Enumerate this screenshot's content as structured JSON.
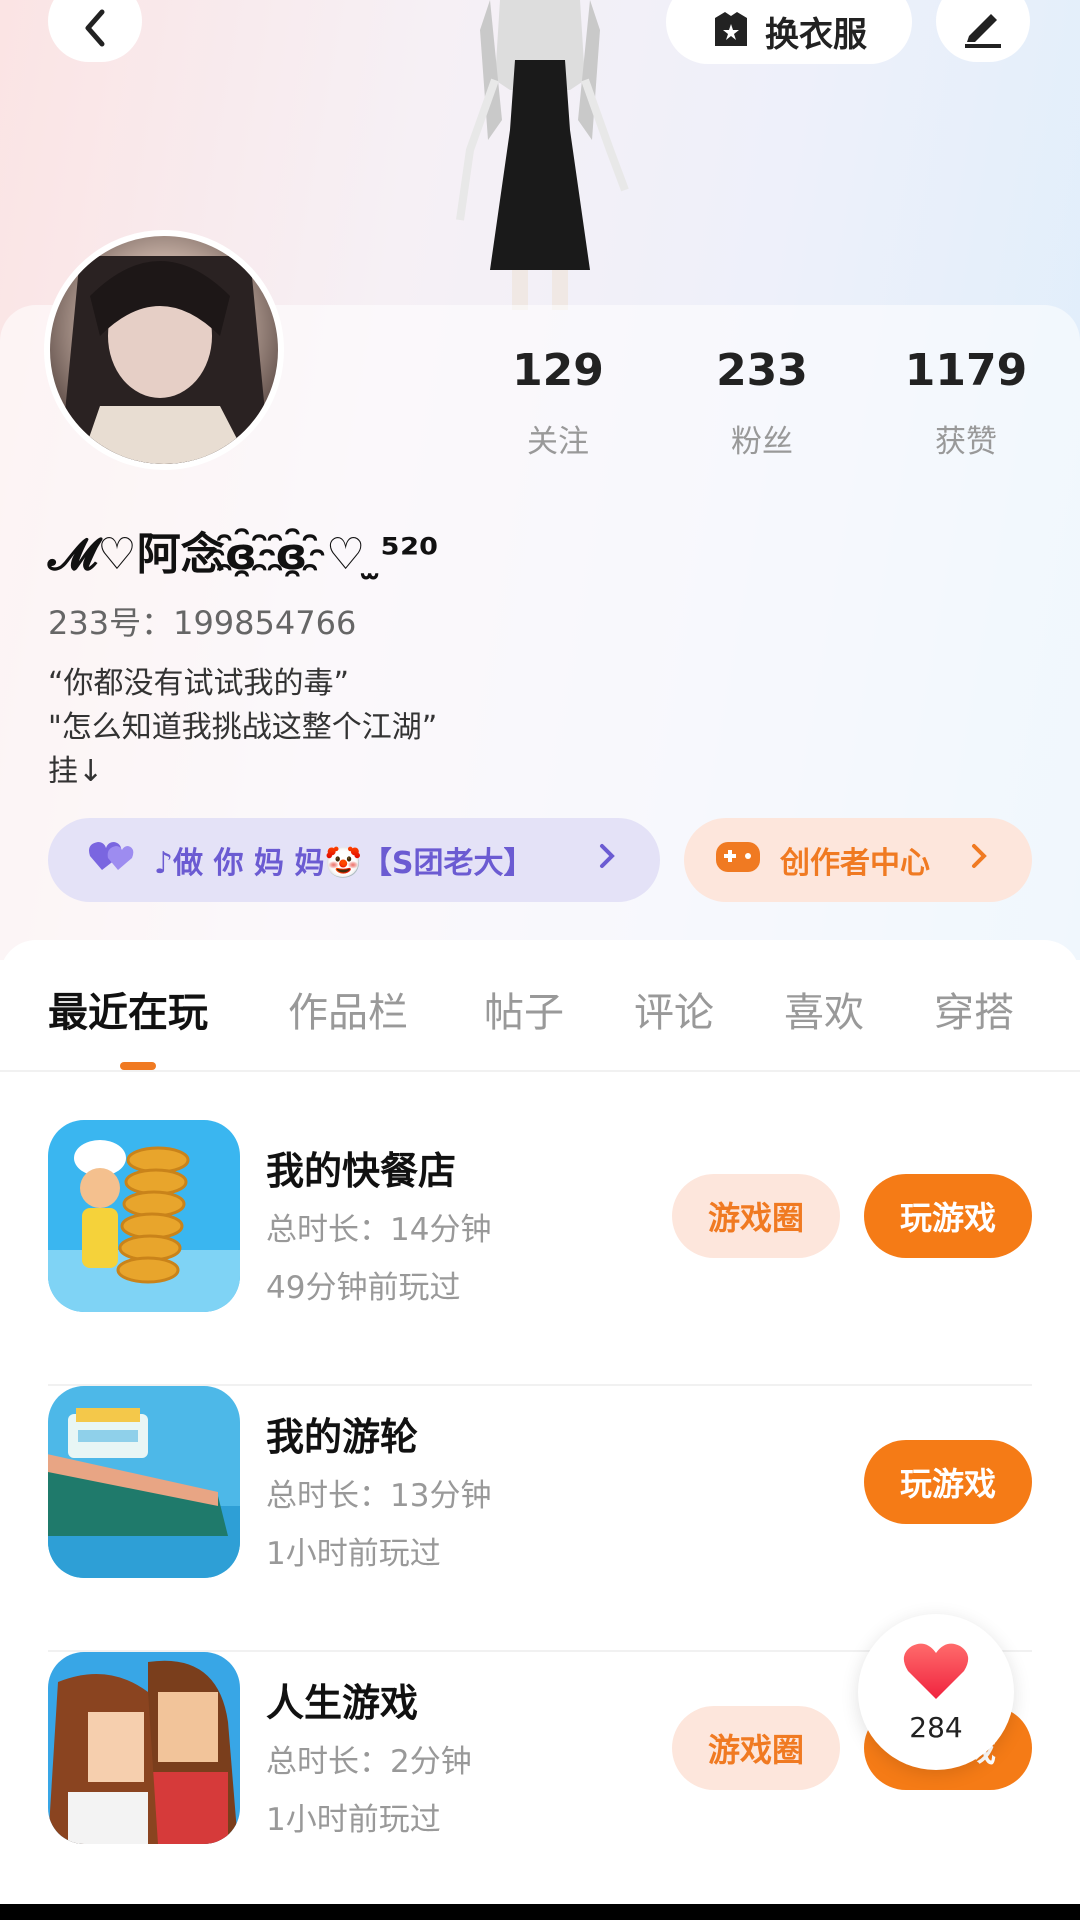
{
  "header": {
    "outfit_label": "换衣服"
  },
  "profile": {
    "stats": [
      {
        "value": "129",
        "label": "关注"
      },
      {
        "value": "233",
        "label": "粉丝"
      },
      {
        "value": "1179",
        "label": "获赞"
      }
    ],
    "username": "𝓜♡阿念ɞ҈ɞ҈♡ ̫⁵²⁰",
    "user_id": "233号：199854766",
    "bio": [
      "“你都没有试试我的毒”",
      "\"怎么知道我挑战这整个江湖”",
      "挂↓"
    ],
    "group_pill": "♪做 你 妈 妈🤡【S团老大】",
    "creator_pill": "创作者中心"
  },
  "tabs": [
    "最近在玩",
    "作品栏",
    "帖子",
    "评论",
    "喜欢",
    "穿搭"
  ],
  "games": [
    {
      "name": "我的快餐店",
      "total_time": "总时长：14分钟",
      "last_played": "49分钟前玩过",
      "circle_label": "游戏圈",
      "play_label": "玩游戏"
    },
    {
      "name": "我的游轮",
      "total_time": "总时长：13分钟",
      "last_played": "1小时前玩过",
      "play_label": "玩游戏"
    },
    {
      "name": "人生游戏",
      "total_time": "总时长：2分钟",
      "last_played": "1小时前玩过",
      "circle_label": "游戏圈",
      "play_label": "玩游戏"
    }
  ],
  "like_bubble": {
    "count": "284"
  },
  "colors": {
    "accent": "#f57b16",
    "group_pill_text": "#6b5bd2"
  }
}
